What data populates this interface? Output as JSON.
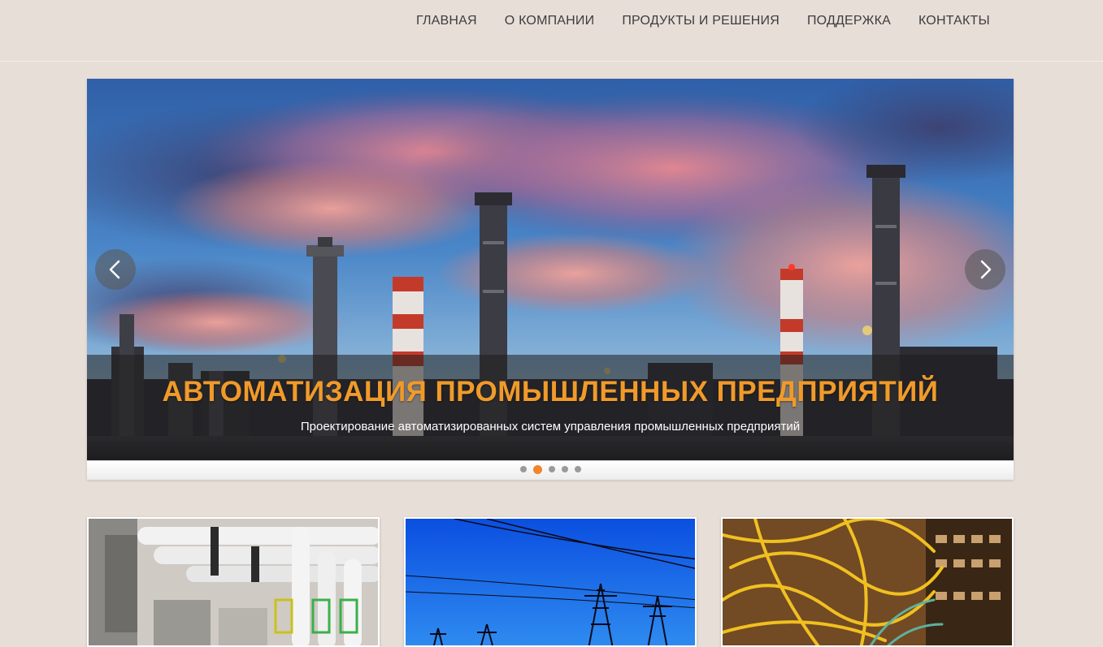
{
  "nav": {
    "items": [
      {
        "label": "ГЛАВНАЯ"
      },
      {
        "label": "О КОМПАНИИ"
      },
      {
        "label": "ПРОДУКТЫ И РЕШЕНИЯ"
      },
      {
        "label": "ПОДДЕРЖКА"
      },
      {
        "label": "КОНТАКТЫ"
      }
    ]
  },
  "slider": {
    "title": "АВТОМАТИЗАЦИЯ ПРОМЫШЛЕННЫХ ПРЕДПРИЯТИЙ",
    "subtitle": "Проектирование автоматизированных систем управления промышленных предприятий",
    "prev_icon": "chevron-left-icon",
    "next_icon": "chevron-right-icon",
    "slide_count": 5,
    "active_slide": 2
  },
  "cards": [
    {
      "image": "industrial-pipes"
    },
    {
      "image": "power-line-towers"
    },
    {
      "image": "network-cables"
    }
  ],
  "colors": {
    "background": "#e8ded8",
    "accent": "#f19a2a",
    "dot_active": "#f0852a",
    "nav_text": "#3d3d3d"
  }
}
